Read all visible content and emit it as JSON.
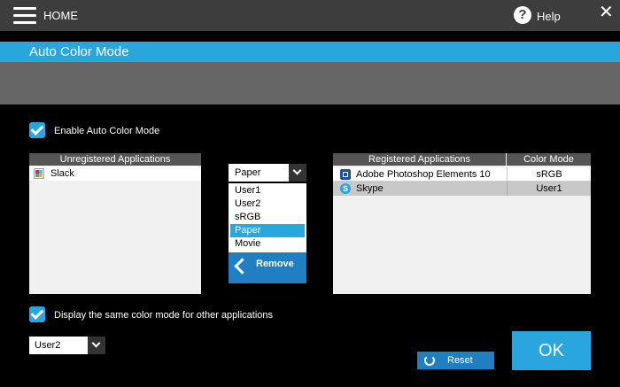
{
  "header": {
    "home_label": "HOME",
    "help_label": "Help"
  },
  "title": "Auto Color Mode",
  "enable_auto": {
    "label": "Enable Auto Color Mode",
    "checked": true
  },
  "unregistered": {
    "header": "Unregistered Applications",
    "apps": [
      {
        "name": "Slack",
        "icon": "slack-icon"
      }
    ]
  },
  "mode_picker": {
    "selected": "Paper",
    "options": [
      "User1",
      "User2",
      "sRGB",
      "Paper",
      "Movie"
    ],
    "remove_label": "Remove"
  },
  "registered": {
    "header_app": "Registered Applications",
    "header_mode": "Color Mode",
    "rows": [
      {
        "name": "Adobe Photoshop Elements 10",
        "mode": "sRGB",
        "icon": "photoshop-elements-icon",
        "selected": false
      },
      {
        "name": "Skype",
        "mode": "User1",
        "icon": "skype-icon",
        "selected": true
      }
    ]
  },
  "same_mode": {
    "label": "Display the same color mode for other applications",
    "checked": true
  },
  "other_apps_mode": {
    "selected": "User2"
  },
  "buttons": {
    "reset_label": "Reset",
    "ok_label": "OK"
  },
  "colors": {
    "accent": "#2aa6df",
    "button_blue": "#1f7fc2",
    "topbar": "#3d3d3d",
    "band": "#666666"
  }
}
